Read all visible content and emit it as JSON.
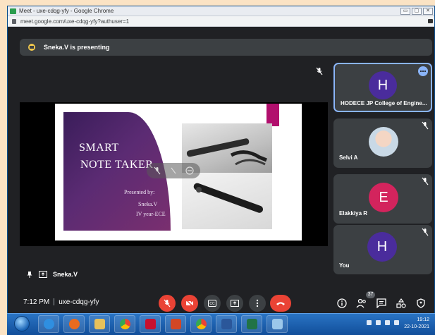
{
  "window": {
    "title": "Meet - uxe-cdqg-yfy - Google Chrome",
    "controls": [
      "▭",
      "▢",
      "✕"
    ]
  },
  "urlbar": {
    "url": "meet.google.com/uxe-cdqg-yfy?authuser=1"
  },
  "presenting": {
    "text": "Sneka.V is presenting"
  },
  "slide": {
    "title_line1": "SMART",
    "title_line2": "NOTE TAKER",
    "presented_by": "Presented by:",
    "presenter": "Sneka.V",
    "class": "IV year-ECE"
  },
  "stage": {
    "name": "Sneka.V"
  },
  "participants": [
    {
      "name": "HODECE JP College of Engine...",
      "initial": "H",
      "avatar_color": "#4a2c9c"
    },
    {
      "name": "Selvi A",
      "initial": "",
      "avatar_color": "#c9d9e6"
    },
    {
      "name": "Elakkiya R",
      "initial": "E",
      "avatar_color": "#d3245d"
    },
    {
      "name": "You",
      "initial": "H",
      "avatar_color": "#4a2c9c"
    }
  ],
  "meeting": {
    "time": "7:12 PM",
    "code": "uxe-cdqg-yfy",
    "participant_count": "37"
  },
  "taskbar": {
    "clock_time": "19:12",
    "clock_date": "22-10-2021"
  },
  "colors": {
    "accent_blue": "#8ab4f8",
    "danger_red": "#ea4335",
    "tile_bg": "#3c4043",
    "bg": "#202124"
  }
}
